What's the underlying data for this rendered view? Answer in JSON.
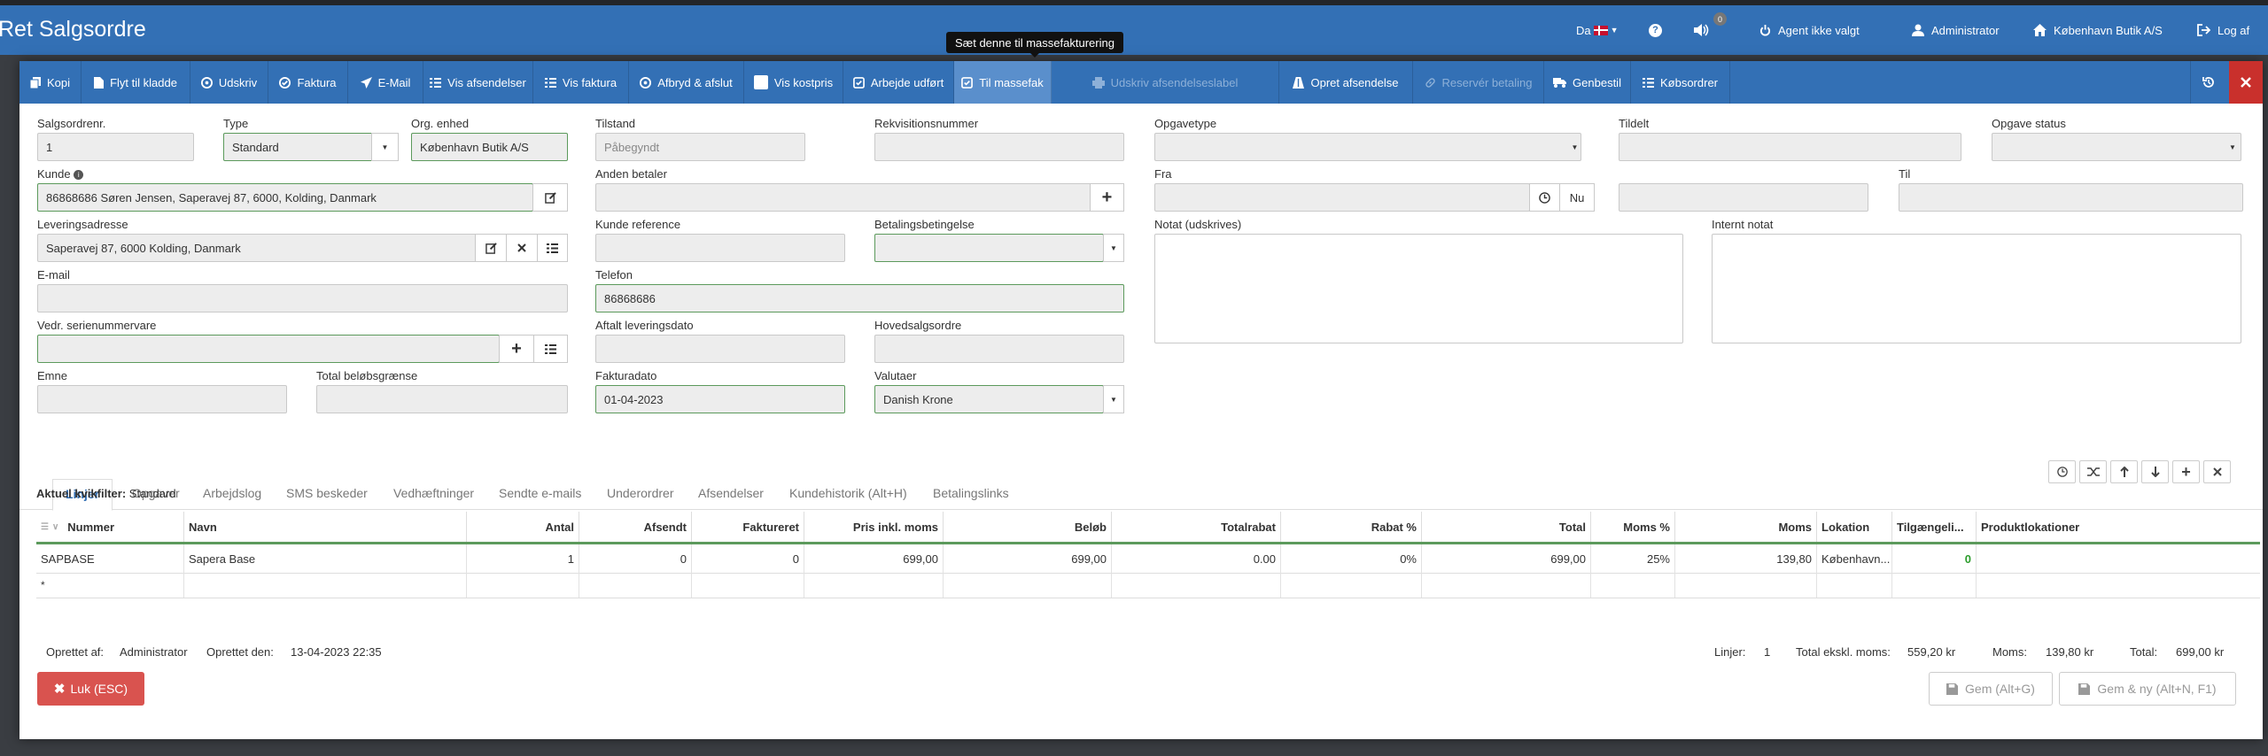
{
  "app": {
    "title": "Ret Salgsordre"
  },
  "navbar": {
    "language": "Da",
    "sound_badge": "0",
    "agent": "Agent ikke valgt",
    "user": "Administrator",
    "shop": "København Butik A/S",
    "logout": "Log af"
  },
  "toolbar": {
    "tooltip": "Sæt denne til massefakturering",
    "buttons": [
      "Kopi",
      "Flyt til kladde",
      "Udskriv",
      "Faktura",
      "E-Mail",
      "Vis afsendelser",
      "Vis faktura",
      "Afbryd & afslut",
      "Vis kostpris",
      "Arbejde udført",
      "Til massefak",
      "Udskriv afsendelseslabel",
      "Opret afsendelse",
      "Reservér betaling",
      "Genbestil",
      "Købsordrer"
    ]
  },
  "form": {
    "labels": {
      "order_no": "Salgsordrenr.",
      "type": "Type",
      "org_unit": "Org. enhed",
      "state": "Tilstand",
      "requisition": "Rekvisitionsnummer",
      "task_type": "Opgavetype",
      "assigned": "Tildelt",
      "task_status": "Opgave status",
      "customer": "Kunde",
      "other_payer": "Anden betaler",
      "from": "Fra",
      "to": "Til",
      "delivery_address": "Leveringsadresse",
      "customer_reference": "Kunde reference",
      "payment_terms": "Betalingsbetingelse",
      "note_print": "Notat (udskrives)",
      "internal_note": "Internt notat",
      "email": "E-mail",
      "phone": "Telefon",
      "serial_item": "Vedr. serienummervare",
      "agreed_delivery": "Aftalt leveringsdato",
      "main_order": "Hovedsalgsordre",
      "subject": "Emne",
      "total_limit": "Total beløbsgrænse",
      "invoice_date": "Fakturadato",
      "currency": "Valutaer"
    },
    "values": {
      "order_no": "1",
      "type": "Standard",
      "org_unit": "København Butik A/S",
      "state": "Påbegyndt",
      "customer": "86868686 Søren Jensen, Saperavej 87, 6000, Kolding, Danmark",
      "delivery_address": "Saperavej 87, 6000 Kolding, Danmark",
      "phone": "86868686",
      "invoice_date": "01-04-2023",
      "currency": "Danish Krone",
      "now_button": "Nu"
    }
  },
  "tabs": [
    "Linjer",
    "Opgaver",
    "Arbejdslog",
    "SMS beskeder",
    "Vedhæftninger",
    "Sendte e-mails",
    "Underordrer",
    "Afsendelser",
    "Kundehistorik (Alt+H)",
    "Betalingslinks"
  ],
  "filter": {
    "label": "Aktuel kvikfilter:",
    "value": "Standard"
  },
  "grid": {
    "columns": [
      "Nummer",
      "Navn",
      "Antal",
      "Afsendt",
      "Faktureret",
      "Pris inkl. moms",
      "Beløb",
      "Totalrabat",
      "Rabat %",
      "Total",
      "Moms %",
      "Moms",
      "Lokation",
      "Tilgængeli...",
      "Produktlokationer"
    ],
    "rows": [
      {
        "nummer": "SAPBASE",
        "navn": "Sapera Base",
        "antal": "1",
        "afsendt": "0",
        "faktureret": "0",
        "pris": "699,00",
        "beloeb": "699,00",
        "totalrabat": "0.00",
        "rabat": "0%",
        "total": "699,00",
        "moms_pct": "25%",
        "moms": "139,80",
        "lokation": "København...",
        "tilgaengelig": "0",
        "produktlokationer": ""
      }
    ],
    "new_row_marker": "*"
  },
  "footer": {
    "created_by_label": "Oprettet af:",
    "created_by": "Administrator",
    "created_on_label": "Oprettet den:",
    "created_on": "13-04-2023 22:35",
    "lines_label": "Linjer:",
    "lines": "1",
    "total_ex_label": "Total ekskl. moms:",
    "total_ex": "559,20 kr",
    "vat_label": "Moms:",
    "vat": "139,80 kr",
    "total_label": "Total:",
    "total": "699,00 kr"
  },
  "buttons": {
    "close": "Luk (ESC)",
    "save": "Gem (Alt+G)",
    "save_new": "Gem & ny (Alt+N, F1)"
  },
  "colors": {
    "primary": "#3370b5",
    "danger": "#d9534f",
    "valid_border": "#5c9a5c",
    "available": "#2e9e2e"
  },
  "icons": [
    "copy-icon",
    "file-icon",
    "print-icon",
    "check-circle-icon",
    "send-icon",
    "list-icon",
    "ban-icon",
    "checkbox-icon",
    "edit-check-icon",
    "truck-icon",
    "link-icon",
    "cart-icon",
    "user-icon",
    "home-icon",
    "power-icon",
    "logout-icon",
    "question-icon",
    "volume-icon",
    "history-icon",
    "close-icon",
    "plus-icon",
    "clock-icon",
    "edit-icon"
  ]
}
